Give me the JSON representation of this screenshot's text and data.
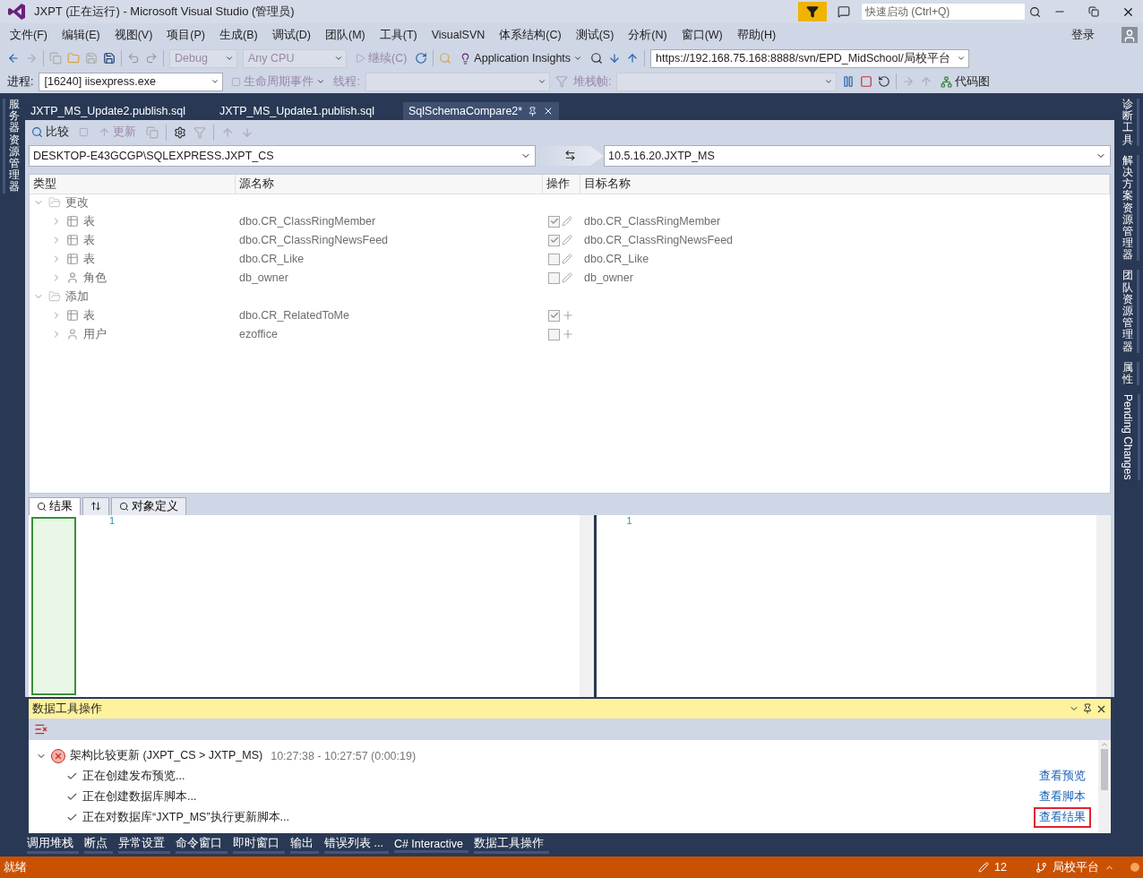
{
  "window": {
    "title": "JXPT (正在运行) - Microsoft Visual Studio (管理员)",
    "quick_launch": {
      "placeholder": "快速启动 (Ctrl+Q)"
    }
  },
  "menu": [
    "文件(F)",
    "编辑(E)",
    "视图(V)",
    "项目(P)",
    "生成(B)",
    "调试(D)",
    "团队(M)",
    "工具(T)",
    "VisualSVN",
    "体系结构(C)",
    "测试(S)",
    "分析(N)",
    "窗口(W)",
    "帮助(H)"
  ],
  "login": "登录",
  "toolbar": {
    "configuration": "Debug",
    "platform": "Any CPU",
    "continue": "继续(C)",
    "insights": "Application Insights",
    "svn_url": "https://192.168.75.168:8888/svn/EPD_MidSchool/局校平台"
  },
  "debug_toolbar": {
    "process_label": "进程:",
    "process": "[16240] iisexpress.exe",
    "lifecycle": "生命周期事件",
    "thread_label": "线程:",
    "stack_label": "堆栈帧:",
    "code_map": "代码图"
  },
  "left_sidebar": [
    "服务器资源管理器"
  ],
  "right_sidebar": [
    {
      "label": "诊断工具",
      "kind": "cjk"
    },
    {
      "label": "解决方案资源管理器",
      "kind": "cjk"
    },
    {
      "label": "团队资源管理器",
      "kind": "cjk"
    },
    {
      "label": "属性",
      "kind": "cjk"
    },
    {
      "label": "Pending Changes",
      "kind": "latin"
    }
  ],
  "doc_tabs": [
    {
      "label": "JXTP_MS_Update2.publish.sql",
      "selected": false
    },
    {
      "label": "JXTP_MS_Update1.publish.sql",
      "selected": false
    },
    {
      "label": "SqlSchemaCompare2*",
      "selected": true
    }
  ],
  "compare_toolbar": {
    "compare": "比较",
    "update": "更新"
  },
  "source": "DESKTOP-E43GCGP\\SQLEXPRESS.JXPT_CS",
  "target": "10.5.16.20.JXTP_MS",
  "grid": {
    "columns": [
      "类型",
      "源名称",
      "操作",
      "目标名称"
    ],
    "groups": [
      {
        "label": "更改",
        "expanded": true,
        "kind": "change",
        "rows": [
          {
            "kind": "table",
            "type": "表",
            "source": "dbo.CR_ClassRingMember",
            "target": "dbo.CR_ClassRingMember",
            "checked": true
          },
          {
            "kind": "table",
            "type": "表",
            "source": "dbo.CR_ClassRingNewsFeed",
            "target": "dbo.CR_ClassRingNewsFeed",
            "checked": true
          },
          {
            "kind": "table",
            "type": "表",
            "source": "dbo.CR_Like",
            "target": "dbo.CR_Like",
            "checked": false
          },
          {
            "kind": "role",
            "type": "角色",
            "source": "db_owner",
            "target": "db_owner",
            "checked": false
          }
        ]
      },
      {
        "label": "添加",
        "expanded": true,
        "kind": "add",
        "rows": [
          {
            "kind": "table",
            "type": "表",
            "source": "dbo.CR_RelatedToMe",
            "checked": true
          },
          {
            "kind": "user",
            "type": "用户",
            "source": "ezoffice",
            "checked": false
          }
        ]
      }
    ]
  },
  "result_tabs": [
    {
      "label": "结果",
      "kind": "text",
      "selected": true
    },
    {
      "kind": "sort",
      "selected": false
    },
    {
      "label": "对象定义",
      "kind": "text",
      "selected": false
    }
  ],
  "diff": {
    "left_line": "1",
    "right_line": "1"
  },
  "data_tools": {
    "title": "数据工具操作",
    "operation": {
      "failed": true,
      "expanded": true,
      "title": "架构比较更新 (JXPT_CS > JXTP_MS)",
      "time": "10:27:38 - 10:27:57 (0:00:19)",
      "steps": [
        {
          "text": "正在创建发布预览...",
          "link": "查看预览",
          "highlighted": false
        },
        {
          "text": "正在创建数据库脚本...",
          "link": "查看脚本",
          "highlighted": false
        },
        {
          "text": "正在对数据库“JXTP_MS”执行更新脚本...",
          "link": "查看结果",
          "highlighted": true
        }
      ]
    }
  },
  "bottom_tabs": [
    "调用堆栈",
    "断点",
    "异常设置",
    "命令窗口",
    "即时窗口",
    "输出",
    "错误列表 ...",
    "C# Interactive",
    "数据工具操作"
  ],
  "status_bar": {
    "text": "就绪",
    "changes": "12",
    "branch": "局校平台"
  }
}
